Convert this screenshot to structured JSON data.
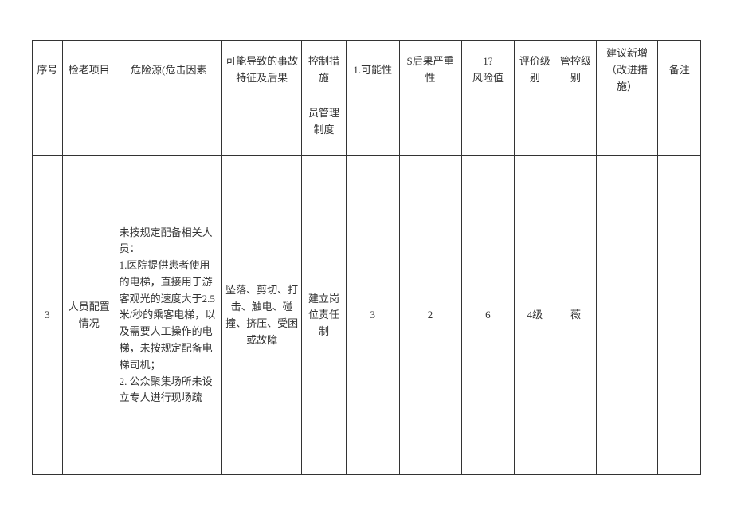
{
  "headers": {
    "seq": "序号",
    "item": "检老项目",
    "hazard": "危险源(危击因素",
    "consequence": "可能导致的事故特征及后果",
    "control": "控制措施",
    "possibility": "1.可能性",
    "severity": "S后果严重性",
    "risk": "1?\n风险值",
    "eval": "评价级别",
    "mgmt": "管控级别",
    "suggest": "建议新增（改进措施）",
    "note": "备注"
  },
  "partial_row": {
    "control": "员管理制度"
  },
  "rows": [
    {
      "seq": "3",
      "item": "人员配置情况",
      "hazard": "未按规定配备相关人员：\n1.医院提供患者使用的电梯，直接用于游客观光的速度大于2.5米/秒的乘客电梯，以及需要人工操作的电梯，未按规定配备电梯司机；\n2. 公众聚集场所未设立专人进行现场疏",
      "consequence": "坠落、剪切、打击、触电、碰撞、挤压、受困或故障",
      "control": "建立岗位责任制",
      "possibility": "3",
      "severity": "2",
      "risk": "6",
      "eval": "4级",
      "mgmt": "薇",
      "suggest": "",
      "note": ""
    }
  ]
}
